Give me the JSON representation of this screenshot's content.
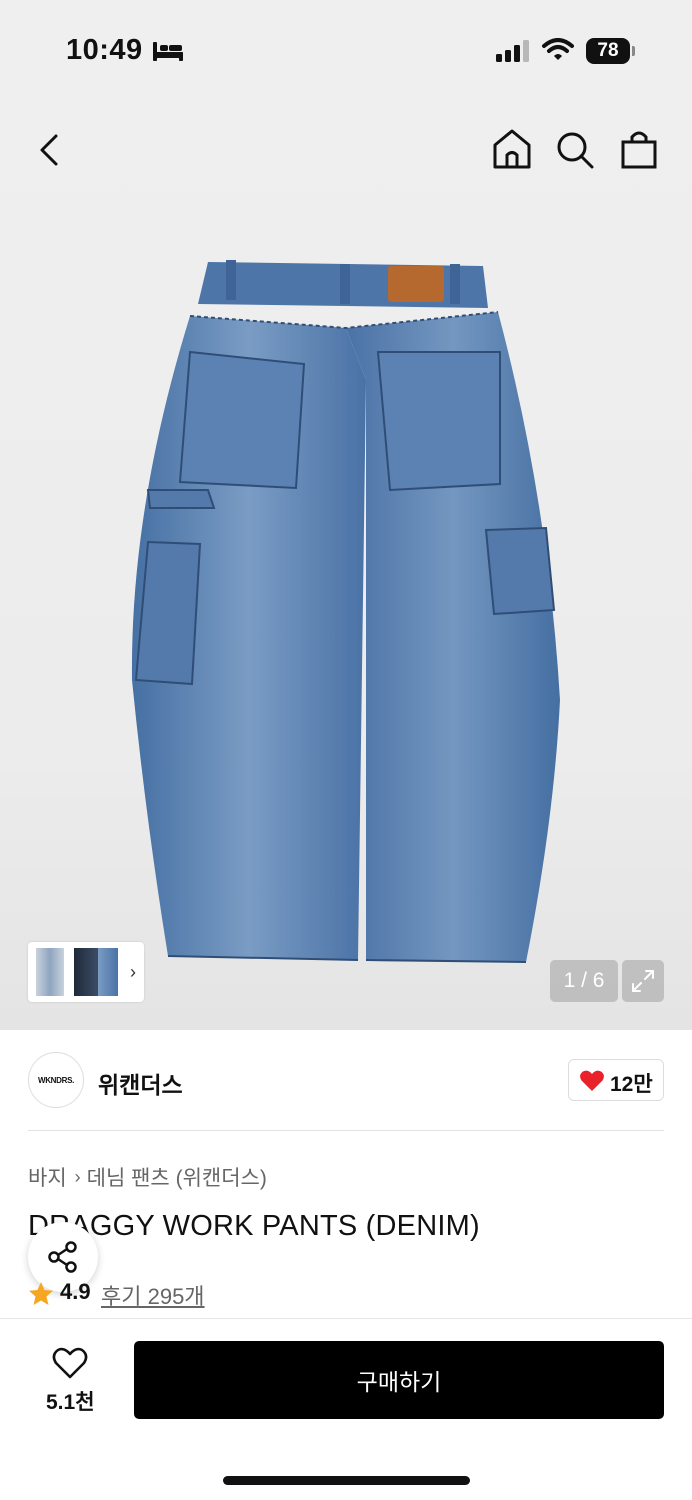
{
  "status_bar": {
    "time": "10:49",
    "battery": "78"
  },
  "gallery": {
    "counter": "1 / 6"
  },
  "brand": {
    "logo_text": "WKNDRS.",
    "name": "위캔더스",
    "likes": "12만"
  },
  "breadcrumb": {
    "category": "바지",
    "subcategory": "데님 팬츠 (위캔더스)"
  },
  "product": {
    "title": "DRAGGY WORK PANTS (DENIM)",
    "rating": "4.9",
    "reviews": "후기 295개"
  },
  "bottom_bar": {
    "wish_count": "5.1천",
    "buy_label": "구매하기"
  },
  "colors": {
    "heart": "#e8212b",
    "star": "#f5a623",
    "denim": "#4a72a6",
    "buy_button": "#000000"
  },
  "icons": [
    "bed-icon",
    "signal-icon",
    "wifi-icon",
    "back-icon",
    "home-icon",
    "search-icon",
    "bag-icon",
    "expand-icon",
    "heart-icon",
    "share-icon",
    "star-icon"
  ]
}
